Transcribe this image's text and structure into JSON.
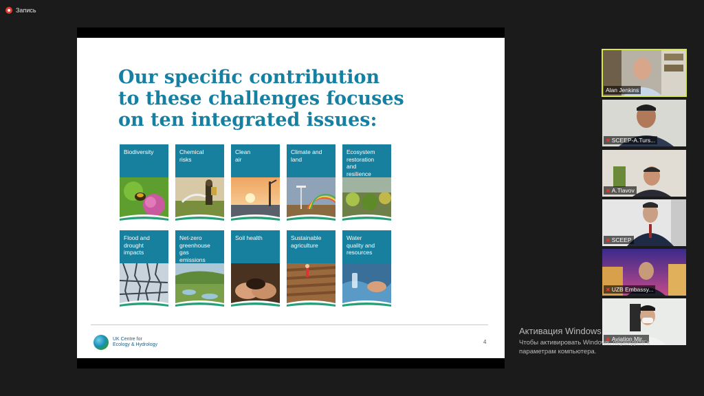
{
  "recording": {
    "label": "Запись"
  },
  "slide": {
    "title_lines": [
      "Our specific contribution",
      "to these challenges focuses",
      "on ten integrated issues:"
    ],
    "tiles": [
      {
        "label_lines": [
          "Biodiversity"
        ]
      },
      {
        "label_lines": [
          "Chemical",
          "risks"
        ]
      },
      {
        "label_lines": [
          "Clean",
          "air"
        ]
      },
      {
        "label_lines": [
          "Climate and",
          "land"
        ]
      },
      {
        "label_lines": [
          "Ecosystem",
          "restoration",
          "and",
          "resilience"
        ]
      },
      {
        "label_lines": [
          "Flood and",
          "drought",
          "impacts"
        ]
      },
      {
        "label_lines": [
          "Net-zero",
          "greenhouse",
          "gas",
          "emissions"
        ]
      },
      {
        "label_lines": [
          "Soil health"
        ]
      },
      {
        "label_lines": [
          "Sustainable",
          "agriculture"
        ]
      },
      {
        "label_lines": [
          "Water",
          "quality and",
          "resources"
        ]
      }
    ],
    "logo_lines": [
      "UK Centre for",
      "Ecology & Hydrology"
    ],
    "page_number": "4"
  },
  "watermark": {
    "line1": "Активация Windows",
    "line2": "Чтобы активировать Windows, перейдите к",
    "line3": "параметрам компьютера."
  },
  "participants": [
    {
      "name": "Alan Jenkins",
      "muted": false,
      "active": true
    },
    {
      "name": "SCEEP-A.Turs...",
      "muted": true,
      "active": false
    },
    {
      "name": "A.Tlavov",
      "muted": true,
      "active": false
    },
    {
      "name": "SCEEP",
      "muted": true,
      "active": false
    },
    {
      "name": "UZB Embassy...",
      "muted": true,
      "active": false
    },
    {
      "name": "Aviation Mir...",
      "muted": true,
      "active": false
    }
  ],
  "colors": {
    "accent": "#1580a1",
    "tile": "#17809e",
    "active_border": "#d8e84a"
  }
}
